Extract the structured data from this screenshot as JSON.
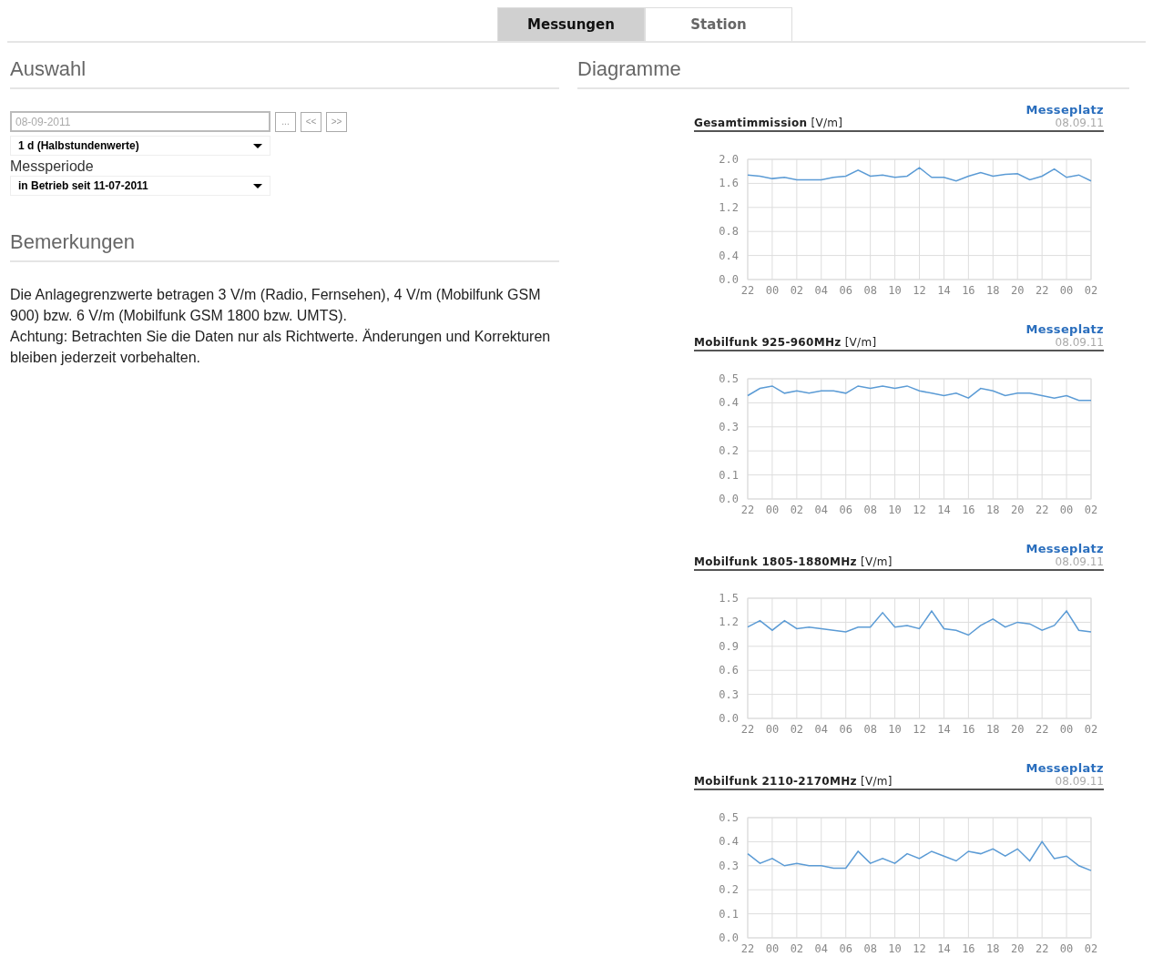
{
  "tabs": [
    {
      "label": "Messungen",
      "selected": true
    },
    {
      "label": "Station",
      "selected": false
    }
  ],
  "selection": {
    "heading": "Auswahl",
    "date_field": {
      "placeholder": "08-09-2011"
    },
    "buttons": [
      "...",
      "<<",
      ">>"
    ],
    "interval_select": {
      "value": "1 d (Halbstundenwerte)"
    },
    "period_label": "Messperiode",
    "period_select": {
      "value": "in Betrieb seit 11-07-2011"
    }
  },
  "remarks": {
    "heading": "Bemerkungen",
    "paragraphs": [
      "Die Anlagegrenzwerte betragen 3 V/m (Radio, Fernsehen), 4 V/m (Mobilfunk GSM 900) bzw. 6 V/m (Mobilfunk GSM 1800 bzw. UMTS).",
      "Achtung: Betrachten Sie die Daten nur als Richtwerte. Änderungen und Korrekturen bleiben jederzeit vorbehalten."
    ]
  },
  "diagrams": {
    "heading": "Diagramme",
    "charts": [
      {
        "location_link": "Messeplatz",
        "date": "08.09.11",
        "chart_data": {
          "type": "line",
          "grid": true,
          "title": "**Gesamtimmission** [V/m]",
          "ylim": [
            0,
            2
          ],
          "yticks": [
            {
              "value": 0,
              "label": "0.0"
            },
            {
              "value": 0.4,
              "label": "0.4"
            },
            {
              "value": 0.8,
              "label": "0.8"
            },
            {
              "value": 1.2,
              "label": "1.2"
            },
            {
              "value": 1.6,
              "label": "1.6"
            },
            {
              "value": 2,
              "label": "2.0"
            }
          ],
          "categories": [
            "22",
            null,
            "00",
            null,
            "02",
            null,
            "04",
            null,
            "06",
            null,
            "08",
            null,
            "10",
            null,
            "12",
            null,
            "14",
            null,
            "16",
            null,
            "18",
            null,
            "20",
            null,
            "22",
            null,
            "00",
            null,
            "02"
          ],
          "series": [
            {
              "color": "#5b9bd5",
              "values": [
                1.74,
                1.72,
                1.68,
                1.7,
                1.66,
                1.66,
                1.66,
                1.7,
                1.72,
                1.82,
                1.72,
                1.74,
                1.7,
                1.72,
                1.86,
                1.7,
                1.7,
                1.64,
                1.72,
                1.78,
                1.72,
                1.75,
                1.76,
                1.66,
                1.72,
                1.84,
                1.7,
                1.74,
                1.64
              ]
            }
          ]
        }
      },
      {
        "location_link": "Messeplatz",
        "date": "08.09.11",
        "chart_data": {
          "type": "line",
          "grid": true,
          "title": "**Mobilfunk 925-960MHz** [V/m]",
          "ylim": [
            0,
            0.5
          ],
          "yticks": [
            {
              "value": 0,
              "label": "0.0"
            },
            {
              "value": 0.1,
              "label": "0.1"
            },
            {
              "value": 0.2,
              "label": "0.2"
            },
            {
              "value": 0.3,
              "label": "0.3"
            },
            {
              "value": 0.4,
              "label": "0.4"
            },
            {
              "value": 0.5,
              "label": "0.5"
            }
          ],
          "categories": [
            "22",
            null,
            "00",
            null,
            "02",
            null,
            "04",
            null,
            "06",
            null,
            "08",
            null,
            "10",
            null,
            "12",
            null,
            "14",
            null,
            "16",
            null,
            "18",
            null,
            "20",
            null,
            "22",
            null,
            "00",
            null,
            "02"
          ],
          "series": [
            {
              "color": "#5b9bd5",
              "values": [
                0.43,
                0.46,
                0.47,
                0.44,
                0.45,
                0.44,
                0.45,
                0.45,
                0.44,
                0.47,
                0.46,
                0.47,
                0.46,
                0.47,
                0.45,
                0.44,
                0.43,
                0.44,
                0.42,
                0.46,
                0.45,
                0.43,
                0.44,
                0.44,
                0.43,
                0.42,
                0.43,
                0.41,
                0.41
              ]
            }
          ]
        }
      },
      {
        "location_link": "Messeplatz",
        "date": "08.09.11",
        "chart_data": {
          "type": "line",
          "grid": true,
          "title": "**Mobilfunk 1805-1880MHz** [V/m]",
          "ylim": [
            0,
            1.5
          ],
          "yticks": [
            {
              "value": 0,
              "label": "0.0"
            },
            {
              "value": 0.3,
              "label": "0.3"
            },
            {
              "value": 0.6,
              "label": "0.6"
            },
            {
              "value": 0.9,
              "label": "0.9"
            },
            {
              "value": 1.2,
              "label": "1.2"
            },
            {
              "value": 1.5,
              "label": "1.5"
            }
          ],
          "categories": [
            "22",
            null,
            "00",
            null,
            "02",
            null,
            "04",
            null,
            "06",
            null,
            "08",
            null,
            "10",
            null,
            "12",
            null,
            "14",
            null,
            "16",
            null,
            "18",
            null,
            "20",
            null,
            "22",
            null,
            "00",
            null,
            "02"
          ],
          "series": [
            {
              "color": "#5b9bd5",
              "values": [
                1.14,
                1.22,
                1.1,
                1.22,
                1.12,
                1.14,
                1.12,
                1.1,
                1.08,
                1.14,
                1.14,
                1.32,
                1.14,
                1.16,
                1.12,
                1.34,
                1.12,
                1.1,
                1.04,
                1.16,
                1.24,
                1.14,
                1.2,
                1.18,
                1.1,
                1.16,
                1.34,
                1.1,
                1.08
              ]
            }
          ]
        }
      },
      {
        "location_link": "Messeplatz",
        "date": "08.09.11",
        "chart_data": {
          "type": "line",
          "grid": true,
          "title": "**Mobilfunk 2110-2170MHz** [V/m]",
          "ylim": [
            0,
            0.5
          ],
          "yticks": [
            {
              "value": 0,
              "label": "0.0"
            },
            {
              "value": 0.1,
              "label": "0.1"
            },
            {
              "value": 0.2,
              "label": "0.2"
            },
            {
              "value": 0.3,
              "label": "0.3"
            },
            {
              "value": 0.4,
              "label": "0.4"
            },
            {
              "value": 0.5,
              "label": "0.5"
            }
          ],
          "categories": [
            "22",
            null,
            "00",
            null,
            "02",
            null,
            "04",
            null,
            "06",
            null,
            "08",
            null,
            "10",
            null,
            "12",
            null,
            "14",
            null,
            "16",
            null,
            "18",
            null,
            "20",
            null,
            "22",
            null,
            "00",
            null,
            "02"
          ],
          "series": [
            {
              "color": "#5b9bd5",
              "values": [
                0.35,
                0.31,
                0.33,
                0.3,
                0.31,
                0.3,
                0.3,
                0.29,
                0.29,
                0.36,
                0.31,
                0.33,
                0.31,
                0.35,
                0.33,
                0.36,
                0.34,
                0.32,
                0.36,
                0.35,
                0.37,
                0.34,
                0.37,
                0.32,
                0.4,
                0.33,
                0.34,
                0.3,
                0.28
              ]
            }
          ]
        }
      }
    ]
  }
}
